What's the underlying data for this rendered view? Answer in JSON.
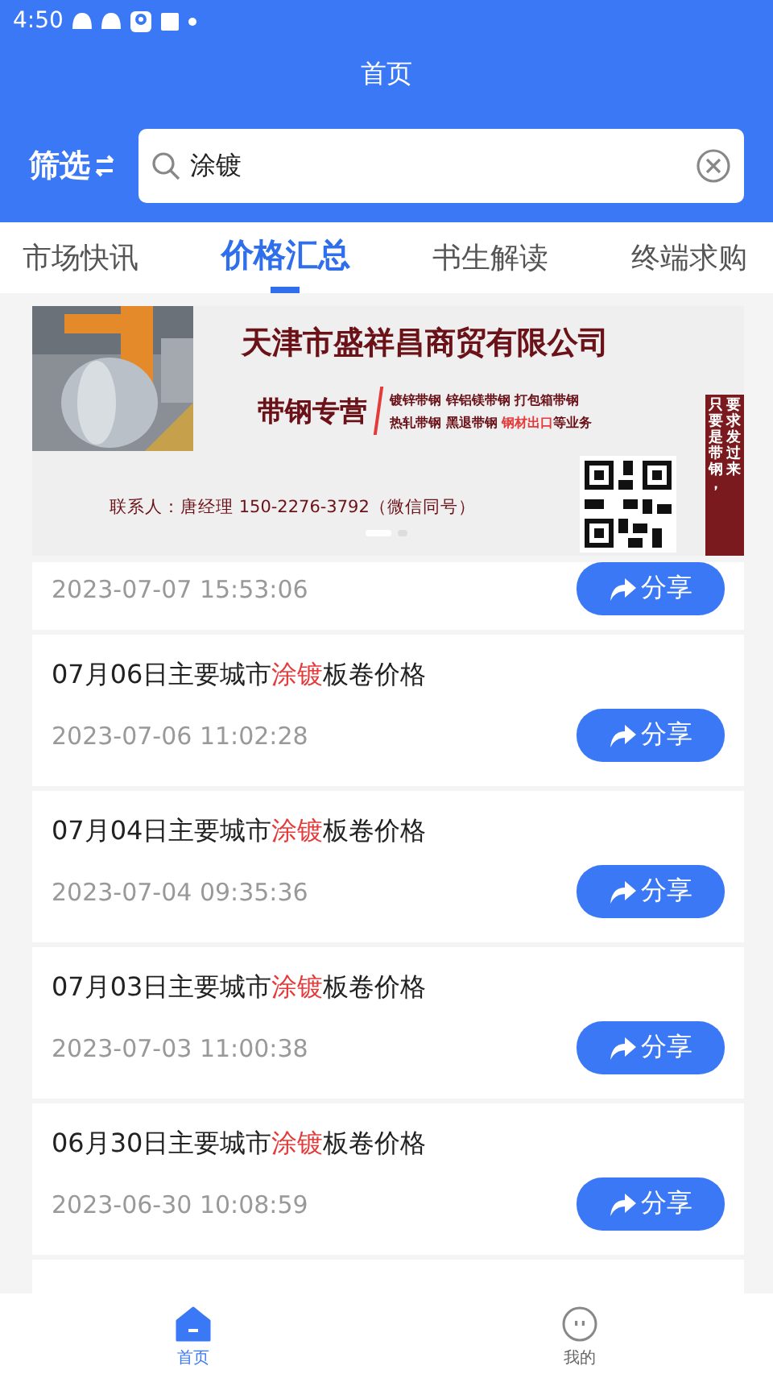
{
  "status_bar": {
    "time": "4:50"
  },
  "header": {
    "title": "首页"
  },
  "filter_button": {
    "label": "筛选"
  },
  "search": {
    "value": "涂镀"
  },
  "tabs": [
    {
      "label": "市场快讯",
      "selected": false
    },
    {
      "label": "价格汇总",
      "selected": true
    },
    {
      "label": "书生解读",
      "selected": false
    },
    {
      "label": "终端求购",
      "selected": false
    }
  ],
  "banner": {
    "company": "天津市盛祥昌商贸有限公司",
    "slogan": "带钢专营",
    "products_line_1": "镀锌带钢 锌铝镁带钢 打包箱带钢",
    "products_line_2_parts": [
      {
        "text": "热轧带钢 黑退带钢 ",
        "highlight": false
      },
      {
        "text": "钢材出口",
        "highlight": true
      },
      {
        "text": "等业务",
        "highlight": false
      }
    ],
    "contact": "联系人：唐经理 150-2276-3792（微信同号）",
    "side_tag_columns": [
      "只要是带钢，",
      "要求发过来"
    ],
    "pages": [
      {
        "selected": true
      },
      {
        "selected": false
      }
    ]
  },
  "articles": [
    {
      "time": "2023-07-07 15:53:06",
      "share": "分享"
    },
    {
      "title_parts": [
        {
          "text": "07月06日主要城市",
          "highlight": false
        },
        {
          "text": "涂镀",
          "highlight": true
        },
        {
          "text": "板卷价格",
          "highlight": false
        }
      ],
      "time": "2023-07-06 11:02:28",
      "share": "分享"
    },
    {
      "title_parts": [
        {
          "text": "07月04日主要城市",
          "highlight": false
        },
        {
          "text": "涂镀",
          "highlight": true
        },
        {
          "text": "板卷价格",
          "highlight": false
        }
      ],
      "time": "2023-07-04 09:35:36",
      "share": "分享"
    },
    {
      "title_parts": [
        {
          "text": "07月03日主要城市",
          "highlight": false
        },
        {
          "text": "涂镀",
          "highlight": true
        },
        {
          "text": "板卷价格",
          "highlight": false
        }
      ],
      "time": "2023-07-03 11:00:38",
      "share": "分享"
    },
    {
      "title_parts": [
        {
          "text": "06月30日主要城市",
          "highlight": false
        },
        {
          "text": "涂镀",
          "highlight": true
        },
        {
          "text": "板卷价格",
          "highlight": false
        }
      ],
      "time": "2023-06-30 10:08:59",
      "share": "分享"
    }
  ],
  "bottom_nav": [
    {
      "label": "首页",
      "selected": true,
      "kind": "home"
    },
    {
      "label": "我的",
      "selected": false,
      "kind": "profile"
    }
  ]
}
